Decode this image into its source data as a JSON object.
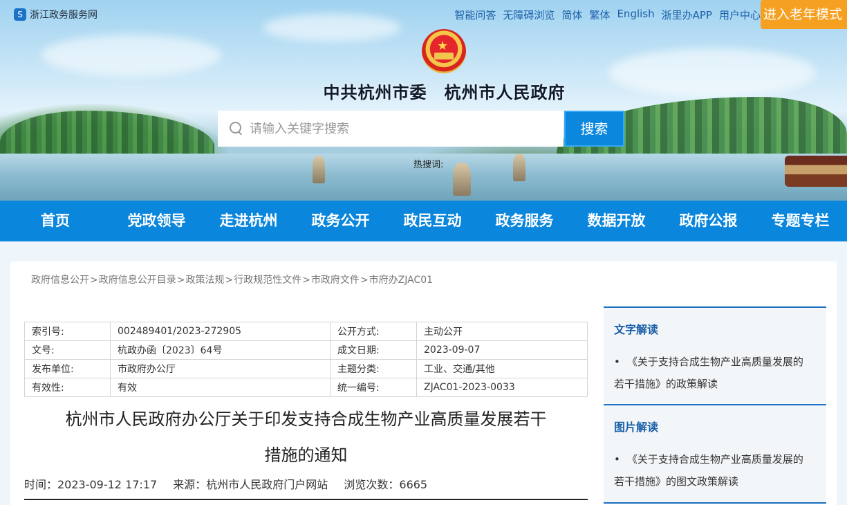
{
  "topbar": {
    "site_name": "浙江政务服务网",
    "links": [
      "智能问答",
      "无障碍浏览",
      "简体",
      "繁体",
      "English",
      "浙里办APP",
      "用户中心"
    ],
    "elder_mode": "进入老年模式"
  },
  "header": {
    "title": "中共杭州市委　杭州市人民政府"
  },
  "search": {
    "placeholder": "请输入关键字搜索",
    "button": "搜索",
    "hot_words_label": "热搜词:"
  },
  "nav": [
    "首页",
    "党政领导",
    "走进杭州",
    "政务公开",
    "政民互动",
    "政务服务",
    "数据开放",
    "政府公报",
    "专题专栏"
  ],
  "breadcrumb": [
    "政府信息公开",
    "政府信息公开目录",
    "政策法规",
    "行政规范性文件",
    "市政府文件",
    "市府办ZJAC01"
  ],
  "meta": [
    {
      "label": "索引号:",
      "value": "002489401/2023-272905",
      "label2": "公开方式:",
      "value2": "主动公开"
    },
    {
      "label": "文号:",
      "value": "杭政办函〔2023〕64号",
      "label2": "成文日期:",
      "value2": "2023-09-07"
    },
    {
      "label": "发布单位:",
      "value": "市政府办公厅",
      "label2": "主题分类:",
      "value2": "工业、交通/其他"
    },
    {
      "label": "有效性:",
      "value": "有效",
      "label2": "统一编号:",
      "value2": "ZJAC01-2023-0033"
    }
  ],
  "document": {
    "title_line1": "杭州市人民政府办公厅关于印发支持合成生物产业高质量发展若干",
    "title_line2": "措施的通知",
    "time": "时间：2023-09-12 17:17",
    "source": "来源：杭州市人民政府门户网站",
    "views": "浏览次数：6665"
  },
  "sidebar": {
    "text_interpret": {
      "heading": "文字解读",
      "items": [
        [
          "《关于支持合成生物产业高质量发展的",
          "若干措施》的政策解读"
        ]
      ]
    },
    "image_interpret": {
      "heading": "图片解读",
      "items": [
        [
          "《关于支持合成生物产业高质量发展的",
          "若干措施》的图文政策解读"
        ]
      ]
    }
  }
}
